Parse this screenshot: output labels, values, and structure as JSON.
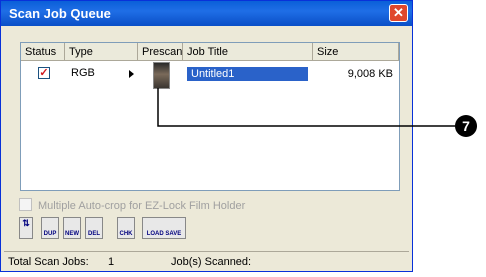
{
  "window": {
    "title": "Scan Job Queue",
    "close_glyph": "✕"
  },
  "columns": [
    "Status",
    "Type",
    "Prescan",
    "Job Title",
    "Size"
  ],
  "job": {
    "checked_glyph": "✓",
    "type": "RGB",
    "title": "Untitled1",
    "size": "9,008 KB"
  },
  "option": {
    "label": "Multiple Auto-crop for EZ-Lock Film Holder"
  },
  "toolbar": {
    "buttons": [
      {
        "label": "",
        "icon": "move-up-down-icon"
      },
      {
        "label": "DUP",
        "icon": "duplicate-icon"
      },
      {
        "label": "NEW",
        "icon": "new-icon"
      },
      {
        "label": "DEL",
        "icon": "delete-icon"
      },
      {
        "label": "CHK",
        "icon": "check-icon"
      },
      {
        "label": "LOAD SAVE",
        "icon": "load-save-icon"
      }
    ]
  },
  "status": {
    "total_label": "Total Scan Jobs:",
    "total_value": "1",
    "scanned_label": "Job(s) Scanned:"
  },
  "callout": {
    "number": "7"
  }
}
